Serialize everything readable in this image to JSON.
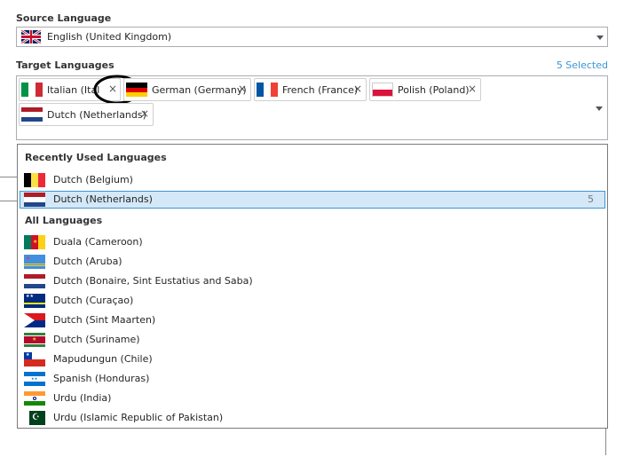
{
  "source": {
    "label": "Source Language",
    "value": "English (United Kingdom)",
    "flag_icon": "uk-flag-icon"
  },
  "target": {
    "label": "Target Languages",
    "selected_count_label": "5 Selected",
    "tags": [
      {
        "label": "Italian (Ital",
        "flag_icon": "italy-flag-icon"
      },
      {
        "label": "German (Germany)",
        "flag_icon": "germany-flag-icon"
      },
      {
        "label": "French (France)",
        "flag_icon": "france-flag-icon"
      },
      {
        "label": "Polish (Poland)",
        "flag_icon": "poland-flag-icon"
      },
      {
        "label": "Dutch (Netherlands)",
        "flag_icon": "netherlands-flag-icon"
      }
    ],
    "remove_glyph": "×"
  },
  "dropdown": {
    "recent_header": "Recently Used Languages",
    "recent": [
      {
        "label": "Dutch (Belgium)",
        "flag_icon": "belgium-flag-icon"
      },
      {
        "label": "Dutch (Netherlands)",
        "flag_icon": "netherlands-flag-icon",
        "count": "5",
        "selected": true
      }
    ],
    "all_header": "All Languages",
    "all": [
      {
        "label": "Duala (Cameroon)",
        "flag_icon": "cameroon-flag-icon"
      },
      {
        "label": "Dutch (Aruba)",
        "flag_icon": "aruba-flag-icon"
      },
      {
        "label": "Dutch (Bonaire, Sint Eustatius and Saba)",
        "flag_icon": "bonaire-flag-icon"
      },
      {
        "label": "Dutch (Curaçao)",
        "flag_icon": "curacao-flag-icon"
      },
      {
        "label": "Dutch (Sint Maarten)",
        "flag_icon": "sint-maarten-flag-icon"
      },
      {
        "label": "Dutch (Suriname)",
        "flag_icon": "suriname-flag-icon"
      },
      {
        "label": "Mapudungun (Chile)",
        "flag_icon": "chile-flag-icon"
      },
      {
        "label": "Spanish (Honduras)",
        "flag_icon": "honduras-flag-icon"
      },
      {
        "label": "Urdu (India)",
        "flag_icon": "india-flag-icon"
      },
      {
        "label": "Urdu (Islamic Republic of Pakistan)",
        "flag_icon": "pakistan-flag-icon"
      }
    ]
  },
  "colors": {
    "accent": "#3d96d6",
    "selection_bg": "#d4e8f7",
    "annotation_circle": "#000000"
  }
}
